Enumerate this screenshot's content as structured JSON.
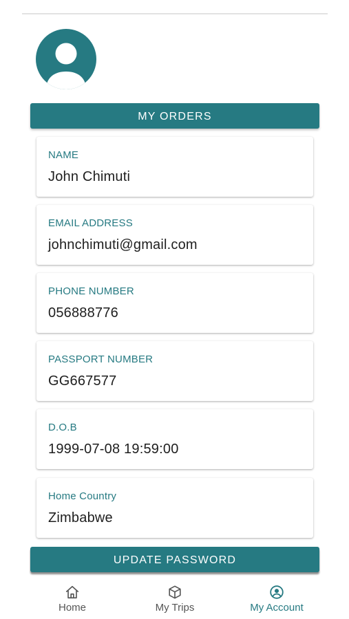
{
  "header": {
    "orders_button_label": "MY ORDERS"
  },
  "profile": {
    "fields": [
      {
        "label": "NAME",
        "value": "John Chimuti"
      },
      {
        "label": "EMAIL ADDRESS",
        "value": "johnchimuti@gmail.com"
      },
      {
        "label": "PHONE NUMBER",
        "value": "056888776"
      },
      {
        "label": "PASSPORT NUMBER",
        "value": "GG667577"
      },
      {
        "label": "D.O.B",
        "value": "1999-07-08 19:59:00"
      },
      {
        "label": "Home Country",
        "value": "Zimbabwe"
      }
    ]
  },
  "actions": {
    "update_password_label": "UPDATE PASSWORD"
  },
  "bottom_nav": {
    "items": [
      {
        "label": "Home",
        "icon": "home-icon",
        "active": false
      },
      {
        "label": "My Trips",
        "icon": "cube-icon",
        "active": false
      },
      {
        "label": "My Account",
        "icon": "account-circle-icon",
        "active": true
      }
    ]
  },
  "colors": {
    "accent": "#267a82",
    "text_primary": "#1e1e1e",
    "nav_inactive": "#555555"
  }
}
